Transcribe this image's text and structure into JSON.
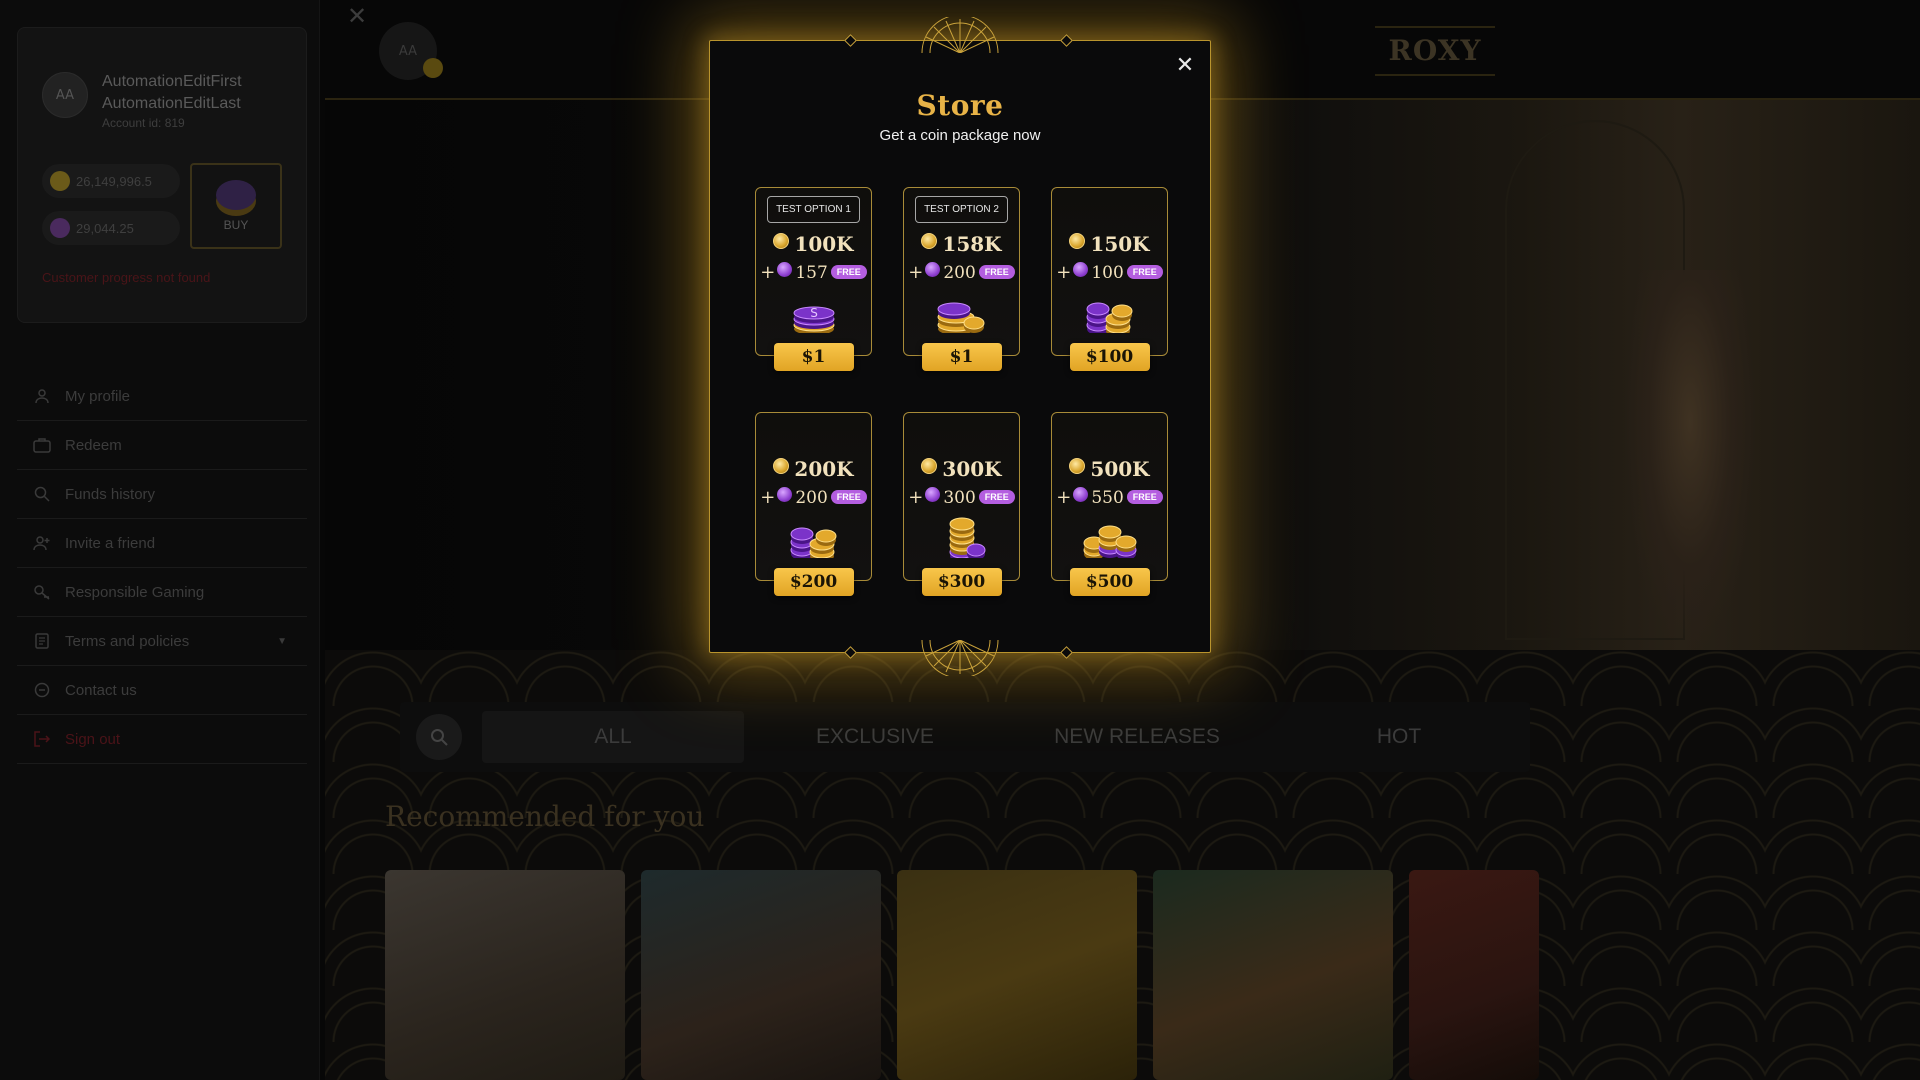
{
  "sidebar": {
    "avatar_initials": "AA",
    "first_name": "AutomationEditFirst",
    "last_name": "AutomationEditLast",
    "account_id": "Account id: 819",
    "gold_balance": "26,149,996.5",
    "sweep_balance": "29,044.25",
    "buy_label": "BUY",
    "progress_error": "Customer progress not found",
    "menu": [
      {
        "label": "My profile",
        "icon": "user-icon"
      },
      {
        "label": "Redeem",
        "icon": "briefcase-icon"
      },
      {
        "label": "Funds history",
        "icon": "search-icon"
      },
      {
        "label": "Invite a friend",
        "icon": "add-user-icon"
      },
      {
        "label": "Responsible Gaming",
        "icon": "gaming-icon"
      },
      {
        "label": "Terms and policies",
        "icon": "document-icon"
      },
      {
        "label": "Contact us",
        "icon": "chat-icon"
      },
      {
        "label": "Sign out",
        "icon": "sign-out-icon"
      }
    ]
  },
  "header": {
    "close_glyph": "✕",
    "avatar_initials": "AA",
    "logo_text": "ROXY"
  },
  "tabs": [
    "ALL",
    "EXCLUSIVE",
    "NEW RELEASES",
    "HOT"
  ],
  "recommended_title": "Recommended for you",
  "games": [
    "",
    "",
    "",
    "",
    ""
  ],
  "store": {
    "title": "Store",
    "subtitle": "Get a coin package now",
    "close_glyph": "✕",
    "packages": [
      {
        "tag": "TEST OPTION 1",
        "gold": "100K",
        "sweep": "157",
        "free": "FREE",
        "price": "$1",
        "stack": "purple-single"
      },
      {
        "tag": "TEST OPTION 2",
        "gold": "158K",
        "sweep": "200",
        "free": "FREE",
        "price": "$1",
        "stack": "purple-gold"
      },
      {
        "tag": "",
        "gold": "150K",
        "sweep": "100",
        "free": "FREE",
        "price": "$100",
        "stack": "mixed"
      },
      {
        "tag": "",
        "gold": "200K",
        "sweep": "200",
        "free": "FREE",
        "price": "$200",
        "stack": "mixed"
      },
      {
        "tag": "",
        "gold": "300K",
        "sweep": "300",
        "free": "FREE",
        "price": "$300",
        "stack": "gold-tower"
      },
      {
        "tag": "",
        "gold": "500K",
        "sweep": "550",
        "free": "FREE",
        "price": "$500",
        "stack": "large"
      }
    ]
  },
  "colors": {
    "accent_gold": "#e8b347",
    "border_gold": "#b9942d",
    "free_badge": "#b45ee0",
    "price_button": "#f1b83a"
  }
}
